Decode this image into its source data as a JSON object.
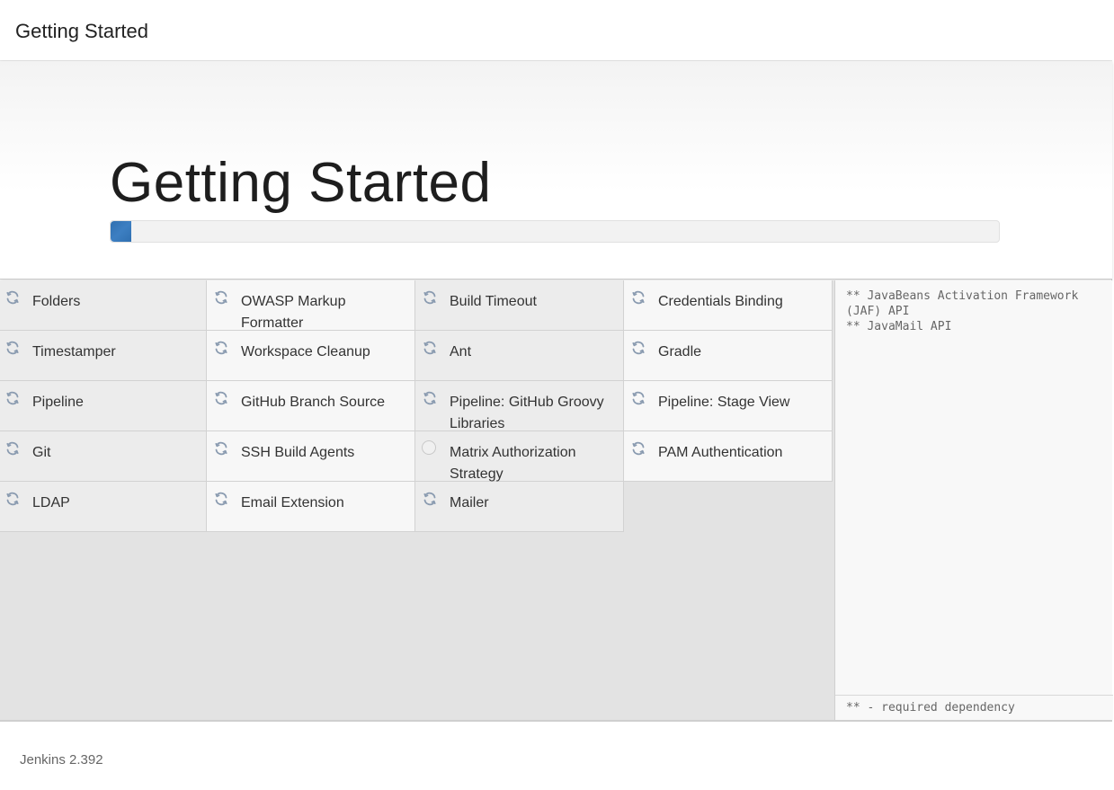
{
  "header": {
    "title": "Getting Started"
  },
  "hero": {
    "title": "Getting Started",
    "progress_fraction": 0.023
  },
  "plugins": [
    {
      "label": "Folders",
      "icon": "refresh-icon",
      "status": "installing"
    },
    {
      "label": "OWASP Markup Formatter",
      "icon": "refresh-icon",
      "status": "installing"
    },
    {
      "label": "Build Timeout",
      "icon": "refresh-icon",
      "status": "installing"
    },
    {
      "label": "Credentials Binding",
      "icon": "refresh-icon",
      "status": "installing"
    },
    {
      "label": "Timestamper",
      "icon": "refresh-icon",
      "status": "installing"
    },
    {
      "label": "Workspace Cleanup",
      "icon": "refresh-icon",
      "status": "installing"
    },
    {
      "label": "Ant",
      "icon": "refresh-icon",
      "status": "installing"
    },
    {
      "label": "Gradle",
      "icon": "refresh-icon",
      "status": "installing"
    },
    {
      "label": "Pipeline",
      "icon": "refresh-icon",
      "status": "installing"
    },
    {
      "label": "GitHub Branch Source",
      "icon": "refresh-icon",
      "status": "installing"
    },
    {
      "label": "Pipeline: GitHub Groovy Libraries",
      "icon": "refresh-icon",
      "status": "installing"
    },
    {
      "label": "Pipeline: Stage View",
      "icon": "refresh-icon",
      "status": "installing"
    },
    {
      "label": "Git",
      "icon": "refresh-icon",
      "status": "installing"
    },
    {
      "label": "SSH Build Agents",
      "icon": "refresh-icon",
      "status": "installing"
    },
    {
      "label": "Matrix Authorization Strategy",
      "icon": "circle-icon",
      "status": "pending"
    },
    {
      "label": "PAM Authentication",
      "icon": "refresh-icon",
      "status": "installing"
    },
    {
      "label": "LDAP",
      "icon": "refresh-icon",
      "status": "installing"
    },
    {
      "label": "Email Extension",
      "icon": "refresh-icon",
      "status": "installing"
    },
    {
      "label": "Mailer",
      "icon": "refresh-icon",
      "status": "installing"
    }
  ],
  "log": {
    "lines": "** JavaBeans Activation Framework (JAF) API\n** JavaMail API",
    "footer": "** - required dependency"
  },
  "footer": {
    "version": "Jenkins 2.392"
  },
  "colors": {
    "accent": "#3d7fc2",
    "icon": "#8a9bb0"
  }
}
